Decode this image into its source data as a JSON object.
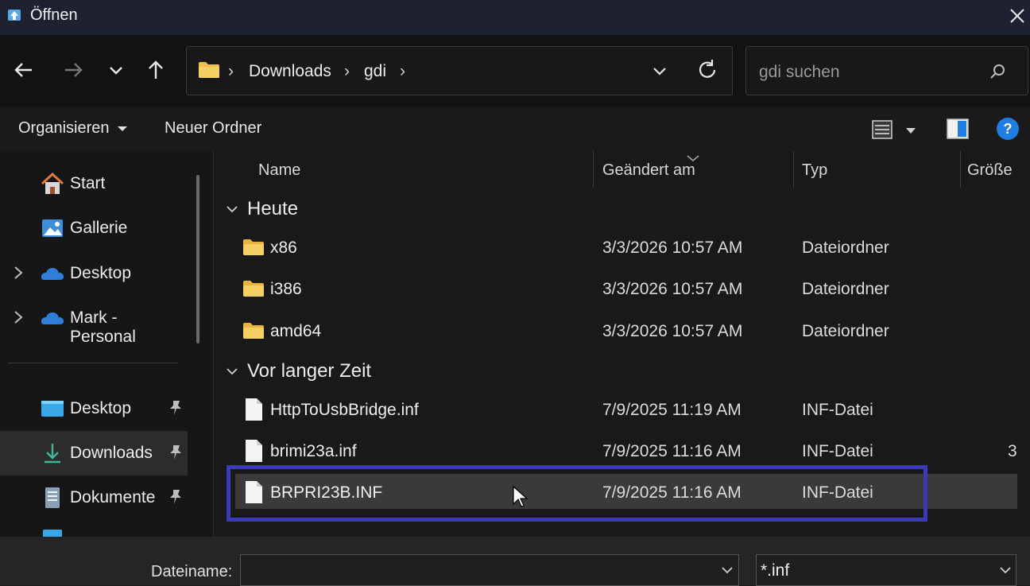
{
  "window": {
    "title": "Öffnen"
  },
  "breadcrumb": {
    "items": [
      "Downloads",
      "gdi"
    ]
  },
  "search": {
    "placeholder": "gdi suchen"
  },
  "commandbar": {
    "organize": "Organisieren",
    "new_folder": "Neuer Ordner"
  },
  "sidebar": {
    "items": [
      {
        "label": "Start",
        "icon": "home-icon",
        "expandable": false,
        "pinned": false
      },
      {
        "label": "Gallerie",
        "icon": "gallery-icon",
        "expandable": false,
        "pinned": false
      },
      {
        "label": "Desktop",
        "icon": "onedrive-icon",
        "expandable": true,
        "pinned": false
      },
      {
        "label": "Mark - Personal",
        "icon": "onedrive-icon",
        "expandable": true,
        "pinned": false
      },
      {
        "label": "Desktop",
        "icon": "desktop-icon",
        "expandable": false,
        "pinned": true
      },
      {
        "label": "Downloads",
        "icon": "download-icon",
        "expandable": false,
        "pinned": true,
        "selected": true
      },
      {
        "label": "Dokumente",
        "icon": "documents-icon",
        "expandable": false,
        "pinned": true
      }
    ]
  },
  "columns": {
    "name": "Name",
    "modified": "Geändert am",
    "type": "Typ",
    "size": "Größe"
  },
  "groups": [
    {
      "label": "Heute",
      "rows": [
        {
          "name": "x86",
          "date": "3/3/2026 10:57 AM",
          "type": "Dateiordner",
          "size": "",
          "icon": "folder-icon"
        },
        {
          "name": "i386",
          "date": "3/3/2026 10:57 AM",
          "type": "Dateiordner",
          "size": "",
          "icon": "folder-icon"
        },
        {
          "name": "amd64",
          "date": "3/3/2026 10:57 AM",
          "type": "Dateiordner",
          "size": "",
          "icon": "folder-icon"
        }
      ]
    },
    {
      "label": "Vor langer Zeit",
      "rows": [
        {
          "name": "HttpToUsbBridge.inf",
          "date": "7/9/2025 11:19 AM",
          "type": "INF-Datei",
          "size": "",
          "icon": "file-icon"
        },
        {
          "name": "brimi23a.inf",
          "date": "7/9/2025 11:16 AM",
          "type": "INF-Datei",
          "size": "3",
          "icon": "file-icon"
        },
        {
          "name": "BRPRI23B.INF",
          "date": "7/9/2025 11:16 AM",
          "type": "INF-Datei",
          "size": "",
          "icon": "file-icon",
          "selected": true
        }
      ]
    }
  ],
  "bottombar": {
    "filename_label": "Dateiname:",
    "filename_value": "",
    "filetype": "*.inf"
  },
  "colors": {
    "accent": "#3b3bb8",
    "folder": "#f0c04a",
    "help": "#1f7ce0"
  }
}
